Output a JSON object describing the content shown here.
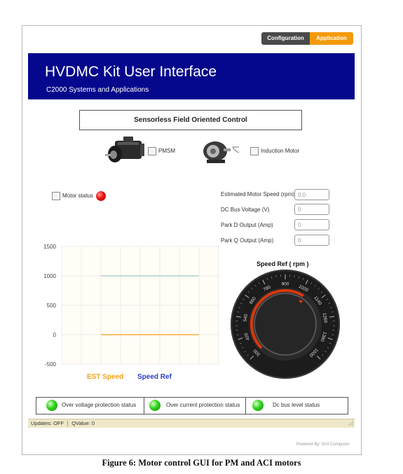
{
  "header_tabs": {
    "configuration": "Configuration",
    "application": "Application"
  },
  "banner": {
    "title": "HVDMC Kit User Interface",
    "subtitle": "C2000 Systems and Applications"
  },
  "control_mode": "Sensorless Field Oriented Control",
  "motor_options": [
    {
      "label": "PMSM",
      "checked": false
    },
    {
      "label": "Induction Motor",
      "checked": false
    }
  ],
  "motor_status": {
    "label": "Motor status",
    "checked": false,
    "led_color": "#ee1010"
  },
  "readouts": [
    {
      "label": "Estimated Motor Speed (rpm)",
      "value": "0.0"
    },
    {
      "label": "DC Bus Voltage (V)",
      "value": "0"
    },
    {
      "label": "Park D Output (Amp)",
      "value": "0"
    },
    {
      "label": "Park Q Output (Amp)",
      "value": "0"
    }
  ],
  "chart_data": {
    "type": "line",
    "x": [
      0,
      1,
      2,
      3,
      4,
      5,
      6,
      7,
      8
    ],
    "series": [
      {
        "name": "EST Speed",
        "color": "#f5a11c",
        "values": [
          null,
          null,
          0,
          0,
          0,
          0,
          0,
          0,
          null
        ]
      },
      {
        "name": "Speed Ref",
        "color": "#2a3ec8",
        "values": [
          null,
          null,
          1000,
          1000,
          1000,
          1000,
          1000,
          1000,
          null
        ]
      }
    ],
    "ylim": [
      -500,
      1500
    ],
    "yticks": [
      "1500",
      "1000",
      "500",
      "0",
      "-500"
    ],
    "grid": true,
    "legend": "bottom"
  },
  "speed_ref": {
    "title": "Speed Ref ( rpm )",
    "ticks": [
      "300",
      "420",
      "540",
      "660",
      "780",
      "900",
      "1020",
      "1140",
      "1260",
      "1380",
      "1500"
    ],
    "value": 300,
    "min": 300,
    "max": 1500
  },
  "status_indicators": [
    {
      "label": "Over voltage protection status",
      "led_color": "#2fd41a"
    },
    {
      "label": "Over current protection status",
      "led_color": "#2fd41a"
    },
    {
      "label": "Dc bus level status",
      "led_color": "#2fd41a"
    }
  ],
  "footer": {
    "updates": "Updates: OFF",
    "qvalue": "QValue: 0",
    "powered_by": "Powered By: GUI Composer"
  },
  "caption": "Figure 6: Motor control GUI for PM and ACI motors"
}
